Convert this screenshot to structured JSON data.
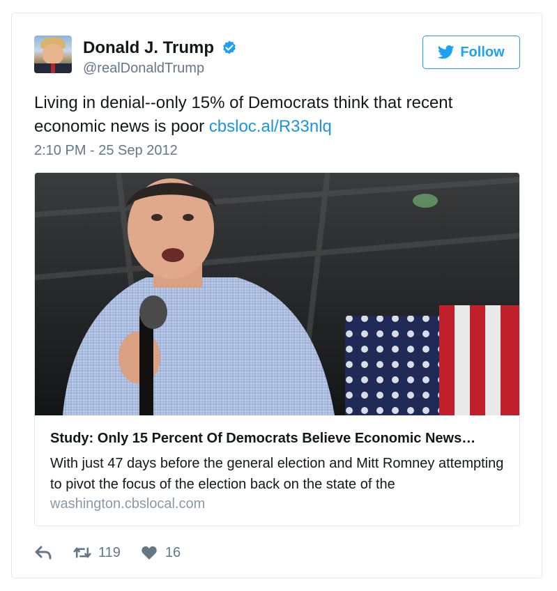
{
  "author": {
    "name": "Donald J. Trump",
    "handle": "@realDonaldTrump",
    "verified_icon": "verified-badge-icon"
  },
  "follow_button": {
    "label": "Follow",
    "icon": "twitter-bird-icon"
  },
  "tweet": {
    "text": "Living in denial--only 15% of Democrats think that recent economic news is poor ",
    "link": "cbsloc.al/R33nlq",
    "timestamp": "2:10 PM - 25 Sep 2012"
  },
  "card": {
    "image_alt": "Mitt Romney speaking into a microphone in front of an American flag",
    "title": "Study: Only 15 Percent Of Democrats Believe Economic News…",
    "description": "With just 47 days before the general election and Mitt Romney attempting to pivot the focus of the election back on the state of the",
    "domain": "washington.cbslocal.com"
  },
  "actions": {
    "reply_icon": "reply-icon",
    "retweet_icon": "retweet-icon",
    "retweet_count": "119",
    "like_icon": "heart-icon",
    "like_count": "16"
  },
  "colors": {
    "accent": "#1da1f2",
    "link": "#1b95e0",
    "secondary_text": "#657786",
    "border": "#e1e8ed"
  }
}
